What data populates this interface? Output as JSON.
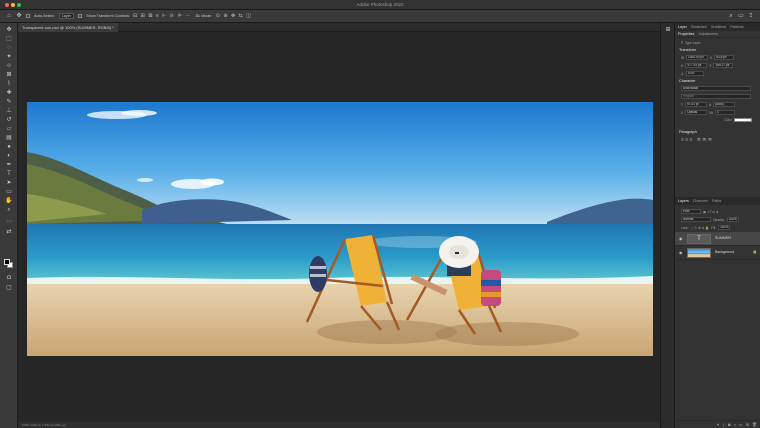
{
  "window": {
    "title": "Adobe Photoshop 2020"
  },
  "options_bar": {
    "move_icon": "move-icon",
    "auto_select_label": "Auto-Select:",
    "auto_select_value": "Layer",
    "transform_label": "Show Transform Controls",
    "align_glyphs": "⊟ ⊞ ⊠ ≡ ⊩ ⊪ ⊫ ⋯",
    "mode_label": "3D Mode:",
    "three_d_glyphs": "⊙ ⊕ ✥ ⇆ ◫"
  },
  "document": {
    "tab_label": "Transparent-sun.psd @ 100% (SUMMER, RGB/8) *"
  },
  "status": {
    "text": "100%    1920 px x 540 px (300 ppi)"
  },
  "right_panel": {
    "tabs": [
      "Layer",
      "Swatches",
      "Gradients",
      "Patterns"
    ],
    "sub_tabs": [
      "Properties",
      "Adjustments"
    ],
    "type_layer": "Type Layer",
    "transform": {
      "title": "Transform",
      "w": "1920.00 px",
      "x": "53.8 px",
      "h": "477.93 px",
      "y": "185.27 px",
      "angle": "0.00°"
    },
    "character": {
      "title": "Character",
      "font": "Arial Black",
      "style": "Regular",
      "size": "97.01 pt",
      "leading": "(Auto)",
      "kerning": "Optical",
      "tracking": "0",
      "color_label": "Color",
      "color_hex": "#ffffff"
    },
    "paragraph": {
      "title": "Paragraph"
    }
  },
  "layers_panel": {
    "tabs": [
      "Layers",
      "Channels",
      "Paths"
    ],
    "kind_label": "Kind",
    "blend_mode": "Normal",
    "opacity_label": "Opacity:",
    "opacity": "100%",
    "lock_label": "Lock:",
    "fill_label": "Fill:",
    "fill": "100%",
    "layers": [
      {
        "name": "SUMMER",
        "type": "text",
        "selected": true
      },
      {
        "name": "Background",
        "type": "image",
        "selected": false
      }
    ]
  }
}
